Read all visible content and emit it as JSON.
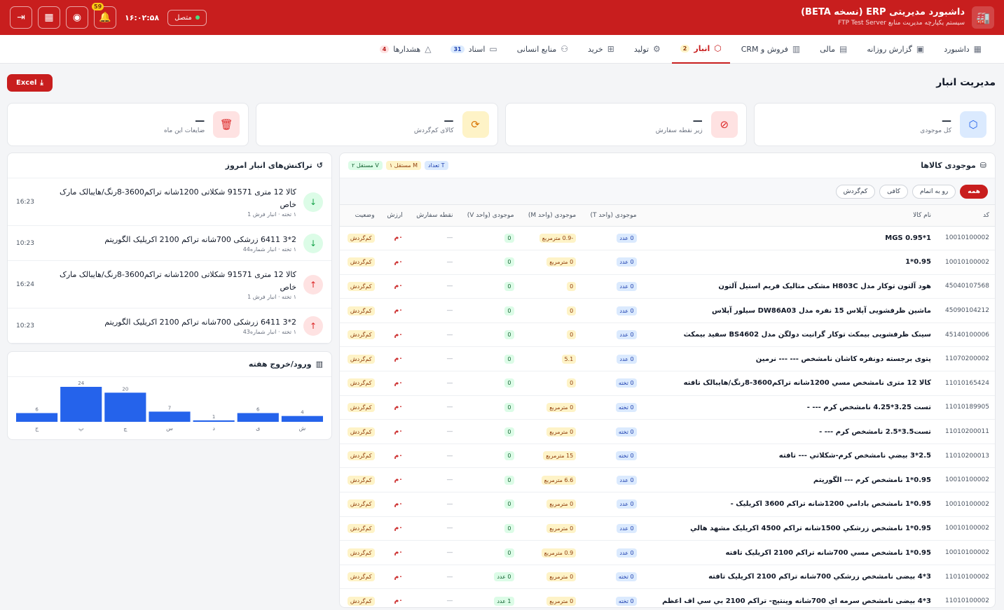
{
  "header": {
    "title": "داشبورد مدیریتی ERP (نسخه BETA)",
    "subtitle": "سیستم یکپارچه مدیریت منابع FTP Test Server",
    "status": "متصل",
    "clock": "۱۶:۰۲:۵۸",
    "notif_count": "59"
  },
  "nav": {
    "items": [
      {
        "label": "داشبورد",
        "icon": "grid-icon"
      },
      {
        "label": "گزارش روزانه",
        "icon": "calendar-icon"
      },
      {
        "label": "مالی",
        "icon": "clipboard-icon"
      },
      {
        "label": "فروش و CRM",
        "icon": "chart-icon"
      },
      {
        "label": "انبار",
        "icon": "box-icon",
        "badge": "2"
      },
      {
        "label": "تولید",
        "icon": "settings-icon"
      },
      {
        "label": "خرید",
        "icon": "cart-icon"
      },
      {
        "label": "منابع انسانی",
        "icon": "users-icon"
      },
      {
        "label": "اسناد",
        "icon": "document-icon",
        "badge": "31"
      },
      {
        "label": "هشدارها",
        "icon": "warning-icon",
        "badge": "4"
      }
    ]
  },
  "page": {
    "title": "مدیریت انبار",
    "excel_label": "Excel"
  },
  "stats": [
    {
      "label": "کل موجودی",
      "value": "—",
      "color": "#dbeafe"
    },
    {
      "label": "زیر نقطه سفارش",
      "value": "—",
      "color": "#fee2e2"
    },
    {
      "label": "کالای کم‌گردش",
      "value": "—",
      "color": "#fef3c7"
    },
    {
      "label": "ضایعات این ماه",
      "value": "—",
      "color": "#fee2e2"
    }
  ],
  "inventory": {
    "title": "موجودی کالاها",
    "chips": {
      "count": "T تعداد",
      "m": "M مستقل ۱",
      "v": "V مستقل ۲"
    },
    "filters": [
      "همه",
      "رو به اتمام",
      "کافی",
      "کم‌گردش"
    ],
    "columns": [
      "کد",
      "نام کالا",
      "موجودی (واحد T)",
      "موجودی (واحد M)",
      "موجودی (واحد V)",
      "نقطه سفارش",
      "ارزش",
      "وضعیت"
    ],
    "rows": [
      {
        "code": "10010100002",
        "name": "MGS 0.95*1",
        "t": "0 عدد",
        "m": "-0.9 مترمربع",
        "v": "0",
        "rop": "—",
        "value": "۰م",
        "status": "کم‌گردش"
      },
      {
        "code": "10010100002",
        "name": "0.95*1",
        "t": "0 عدد",
        "m": "0 مترمربع",
        "v": "0",
        "rop": "—",
        "value": "۰م",
        "status": "کم‌گردش"
      },
      {
        "code": "45040107568",
        "name": "هود آلتون توکار مدل H803C مشکی متالیک فریم استیل آلتون",
        "t": "0 عدد",
        "m": "0",
        "v": "0",
        "rop": "—",
        "value": "۰م",
        "status": "کم‌گردش"
      },
      {
        "code": "45090104212",
        "name": "ماشین ظرفشویی آپلاس 15 نفره مدل DW86A03 سیلور آپلاس",
        "t": "0 عدد",
        "m": "0",
        "v": "0",
        "rop": "—",
        "value": "۰م",
        "status": "کم‌گردش"
      },
      {
        "code": "45140100006",
        "name": "سینک ظرفشویی بیمکث توکار گرانیت دولگن مدل BS4602 سفید بیمکث",
        "t": "0 عدد",
        "m": "0",
        "v": "0",
        "rop": "—",
        "value": "۰م",
        "status": "کم‌گردش"
      },
      {
        "code": "11070200002",
        "name": "پتوی برجسته دونفره کاشان نامشخص --- --- نرمین",
        "t": "0 عدد",
        "m": "5.1",
        "v": "0",
        "rop": "—",
        "value": "۰م",
        "status": "کم‌گردش"
      },
      {
        "code": "11010165424",
        "name": "کالا 12 متری نامشخص مسي 1200شانه تراکم3600-8رنگ/هایبالک تافته",
        "t": "0 تخته",
        "m": "0",
        "v": "0",
        "rop": "—",
        "value": "۰م",
        "status": "کم‌گردش"
      },
      {
        "code": "11010189905",
        "name": "تست 3.25*4.25 نامشخص کرم --- -",
        "t": "0 تخته",
        "m": "0 مترمربع",
        "v": "0",
        "rop": "—",
        "value": "۰م",
        "status": "کم‌گردش"
      },
      {
        "code": "11010200011",
        "name": "تست3.5*2.5 نامشخص کرم --- -",
        "t": "0 تخته",
        "m": "0 مترمربع",
        "v": "0",
        "rop": "—",
        "value": "۰م",
        "status": "کم‌گردش"
      },
      {
        "code": "11010200013",
        "name": "2.5*3 بيضي نامشخص کرم-شکلاتي --- تافته",
        "t": "0 تخته",
        "m": "15 مترمربع",
        "v": "0",
        "rop": "—",
        "value": "۰م",
        "status": "کم‌گردش"
      },
      {
        "code": "10010100002",
        "name": "0.95*1 نامشخص کرم --- الگوریتم",
        "t": "0 عدد",
        "m": "6.6 مترمربع",
        "v": "0",
        "rop": "—",
        "value": "۰م",
        "status": "کم‌گردش"
      },
      {
        "code": "10010100002",
        "name": "0.95*1 نامشخص بادامي 1200شانه تراکم 3600 اکریلیک -",
        "t": "0 عدد",
        "m": "0 مترمربع",
        "v": "0",
        "rop": "—",
        "value": "۰م",
        "status": "کم‌گردش"
      },
      {
        "code": "10010100002",
        "name": "0.95*1 نامشخص زرشکي 1500شانه تراکم 4500 اکریلیک مشهد هالي",
        "t": "0 عدد",
        "m": "0 مترمربع",
        "v": "0",
        "rop": "—",
        "value": "۰م",
        "status": "کم‌گردش"
      },
      {
        "code": "10010100002",
        "name": "0.95*1 نامشخص مسي 700شانه تراکم 2100 اکریلیک تافته",
        "t": "0 عدد",
        "m": "0.9 مترمربع",
        "v": "0",
        "rop": "—",
        "value": "۰م",
        "status": "کم‌گردش"
      },
      {
        "code": "11010100002",
        "name": "3*4 بیضی نامشخص زرشکي 700شانه تراکم 2100 اکریلیک تافته",
        "t": "0 تخته",
        "m": "0 مترمربع",
        "v": "0 عدد",
        "rop": "—",
        "value": "۰م",
        "status": "کم‌گردش"
      },
      {
        "code": "11010100002",
        "name": "3*4 بیضی نامشخص سرمه اي 700شانه وينتيج- تراکم 2100 بي سي اف اعظم",
        "t": "0 تخته",
        "m": "0 مترمربع",
        "v": "1 عدد",
        "rop": "—",
        "value": "۰م",
        "status": "کم‌گردش"
      }
    ]
  },
  "transactions": {
    "title": "تراکنش‌های انبار امروز",
    "items": [
      {
        "title": "کالا 12 متری 91571 شکلاتی 1200شانه تراکم3600-8رنگ/هایبالک مارک خاص",
        "sub": "۱ تخته · انبار فرش 1",
        "time": "16:23",
        "dir": "in"
      },
      {
        "title": "2*3 6411 زرشکی 700شانه تراکم 2100 اکریلیک الگوریتم",
        "sub": "۱ تخته · انبار شماره44",
        "time": "10:23",
        "dir": "in"
      },
      {
        "title": "کالا 12 متری 91571 شکلاتی 1200شانه تراکم3600-8رنگ/هایبالک مارک خاص",
        "sub": "۱ تخته · انبار فرش 1",
        "time": "16:24",
        "dir": "out"
      },
      {
        "title": "2*3 6411 زرشکی 700شانه تراکم 2100 اکریلیک الگوریتم",
        "sub": "۱ تخته · انبار شماره43",
        "time": "10:23",
        "dir": "out"
      }
    ]
  },
  "weekly": {
    "title": "ورود/خروج هفته"
  },
  "chart_data": {
    "type": "bar",
    "categories": [
      "ش",
      "ی",
      "د",
      "س",
      "چ",
      "پ",
      "ج"
    ],
    "values": [
      4,
      6,
      1,
      7,
      20,
      24,
      6
    ],
    "title": "ورود/خروج هفته",
    "color": "#2563eb",
    "ylim": [
      0,
      24
    ]
  }
}
